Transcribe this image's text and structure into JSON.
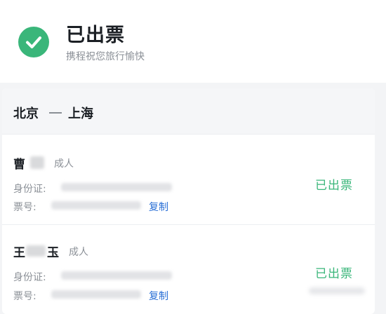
{
  "header": {
    "status_title": "已出票",
    "status_subtitle": "携程祝您旅行愉快",
    "icon": "check-circle-icon",
    "accent_color": "#3ab67a"
  },
  "route": {
    "from": "北京",
    "to": "上海"
  },
  "passengers": [
    {
      "name": "曹",
      "type": "成人",
      "id_label": "身份证:",
      "ticket_label": "票号:",
      "copy_label": "复制",
      "status": "已出票"
    },
    {
      "name_first": "王",
      "name_last": "玉",
      "type": "成人",
      "id_label": "身份证:",
      "ticket_label": "票号:",
      "copy_label": "复制",
      "status": "已出票"
    }
  ],
  "colors": {
    "link": "#2a6fd6",
    "success": "#3ab67a"
  }
}
